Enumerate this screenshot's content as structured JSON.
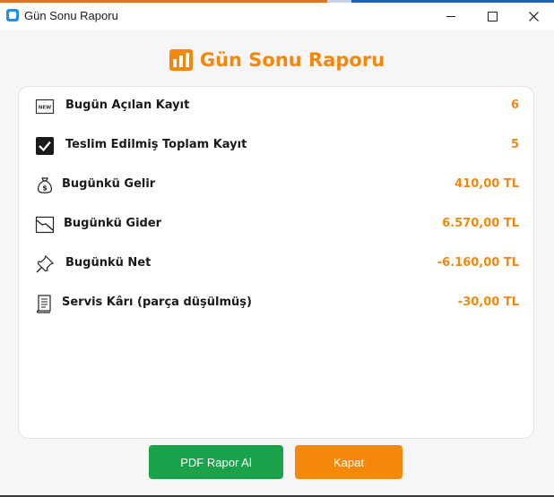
{
  "window": {
    "title": "Gün Sonu Raporu"
  },
  "report": {
    "heading": "Gün Sonu Raporu",
    "accent_color": "#f5870b",
    "rows": [
      {
        "icon": "new-icon",
        "label": "Bugün Açılan Kayıt",
        "value": "6"
      },
      {
        "icon": "checkbox-checked-icon",
        "label": "Teslim Edilmiş Toplam Kayıt",
        "value": "5"
      },
      {
        "icon": "money-bag-icon",
        "label": "Bugünkü Gelir",
        "value": "410,00 TL"
      },
      {
        "icon": "chart-down-icon",
        "label": "Bugünkü Gider",
        "value": "6.570,00 TL"
      },
      {
        "icon": "pushpin-icon",
        "label": "Bugünkü Net",
        "value": "-6.160,00 TL"
      },
      {
        "icon": "scroll-icon",
        "label": "Servis Kârı (parça düşülmüş)",
        "value": "-30,00 TL"
      }
    ]
  },
  "buttons": {
    "pdf_label": "PDF Rapor Al",
    "pdf_color": "#1aa34a",
    "close_label": "Kapat",
    "close_color": "#f5870b"
  }
}
